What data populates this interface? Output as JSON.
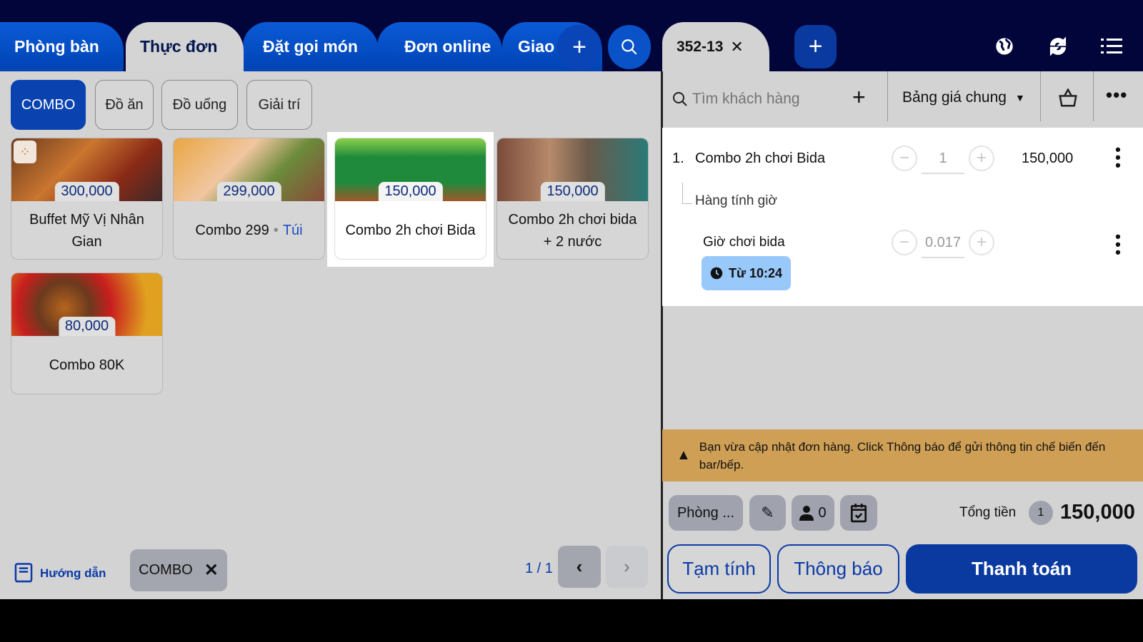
{
  "colors": {
    "navy": "#02053a",
    "accent": "#0a43b0",
    "warning": "#cf9f55",
    "chip_time": "#99c8fb"
  },
  "left_tabs": [
    {
      "label": "Phòng bàn"
    },
    {
      "label": "Thực đơn"
    },
    {
      "label": "Đặt gọi món"
    },
    {
      "label": "Đơn online"
    },
    {
      "label": "Giao"
    }
  ],
  "categories": [
    "COMBO",
    "Đồ ăn",
    "Đồ uống",
    "Giải trí"
  ],
  "products": [
    {
      "name": "Buffet Mỹ Vị Nhân Gian",
      "price": "300,000"
    },
    {
      "name": "Combo 299",
      "unit": "Túi",
      "price": "299,000"
    },
    {
      "name": "Combo 2h chơi Bida",
      "price": "150,000"
    },
    {
      "name": "Combo 2h chơi bida + 2 nước",
      "price": "150,000"
    },
    {
      "name": "Combo 80K",
      "price": "80,000"
    }
  ],
  "footer": {
    "guide": "Hướng dẫn",
    "filter_chip": "COMBO",
    "pagination": "1 / 1"
  },
  "order_tab": {
    "label": "352-13"
  },
  "customer_search": {
    "placeholder": "Tìm khách hàng"
  },
  "price_list": "Bảng giá chung",
  "order_items": [
    {
      "index": "1.",
      "name": "Combo 2h chơi Bida",
      "qty": "1",
      "price": "150,000",
      "sub_label": "Hàng tính giờ",
      "sub_item": {
        "name": "Giờ chơi bida",
        "qty": "0.017",
        "time": "Từ 10:24"
      }
    }
  ],
  "warning": "Bạn vừa cập nhật đơn hàng. Click Thông báo để gửi thông tin chế biến đến bar/bếp.",
  "bottom": {
    "room": "Phòng ...",
    "guests": "0",
    "total_label": "Tổng tiền",
    "total_count": "1",
    "total": "150,000"
  },
  "actions": {
    "provisional": "Tạm tính",
    "notify": "Thông báo",
    "pay": "Thanh toán"
  }
}
